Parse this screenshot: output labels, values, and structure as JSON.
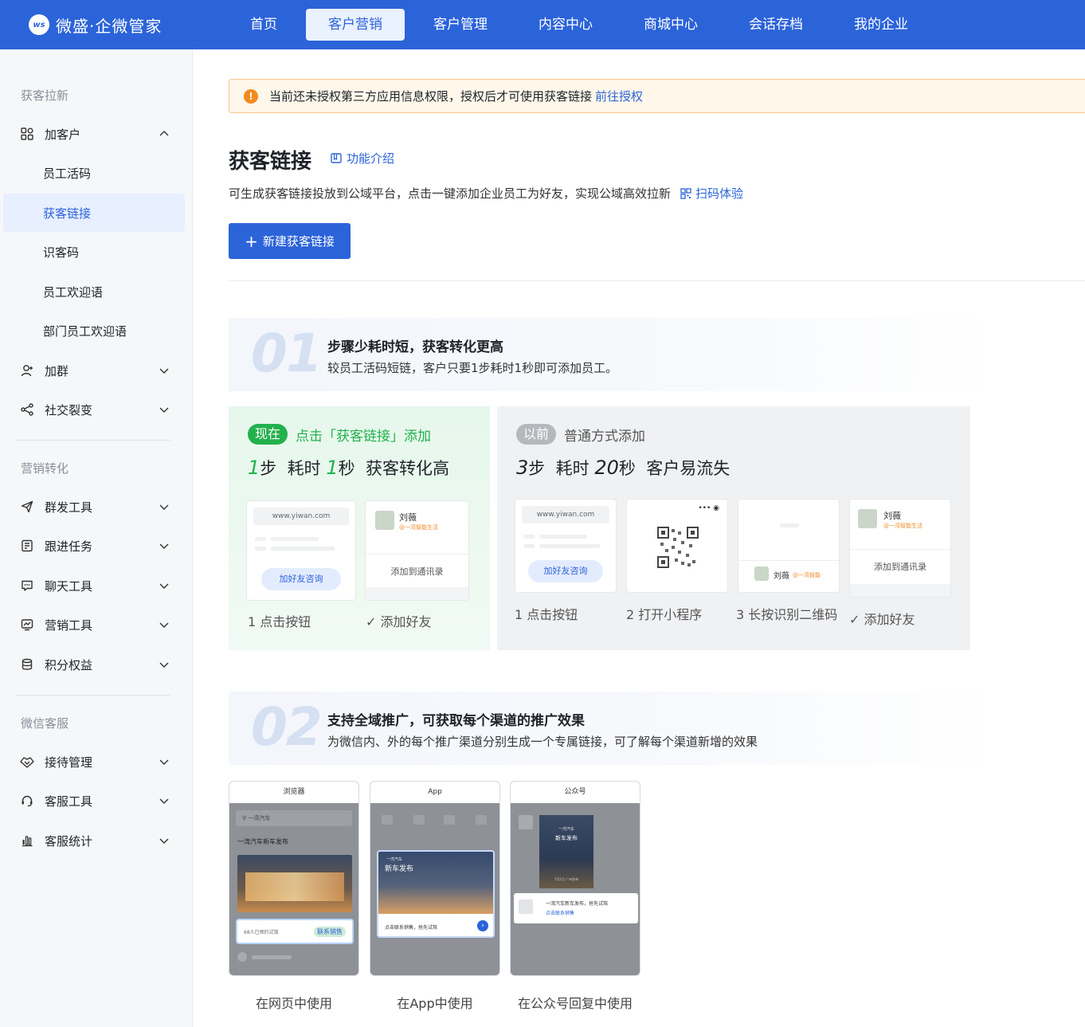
{
  "app": {
    "badge": "ws",
    "name": "微盛·企微管家"
  },
  "nav": [
    "首页",
    "客户营销",
    "客户管理",
    "内容中心",
    "商城中心",
    "会话存档",
    "我的企业"
  ],
  "nav_active": 1,
  "sidebar": {
    "group1": "获客拉新",
    "add_customer": "加客户",
    "sub": [
      "员工活码",
      "获客链接",
      "识客码",
      "员工欢迎语",
      "部门员工欢迎语"
    ],
    "add_group": "加群",
    "social": "社交裂变",
    "group2": "营销转化",
    "g2": [
      "群发工具",
      "跟进任务",
      "聊天工具",
      "营销工具",
      "积分权益"
    ],
    "group3": "微信客服",
    "g3": [
      "接待管理",
      "客服工具",
      "客服统计"
    ]
  },
  "alert": {
    "text": "当前还未授权第三方应用信息权限，授权后才可使用获客链接",
    "link": "前往授权"
  },
  "page": {
    "title": "获客链接",
    "feature": "功能介绍",
    "desc": "可生成获客链接投放到公域平台，点击一键添加企业员工为好友，实现公域高效拉新",
    "scan": "扫码体验",
    "new_button": "新建获客链接"
  },
  "step1": {
    "num": "01",
    "title": "步骤少耗时短，获客转化更高",
    "desc": "较员工活码短链，客户只要1步耗时1秒即可添加员工。"
  },
  "now": {
    "tag": "现在",
    "title": "点击「获客链接」添加",
    "big_a": "1",
    "big_b": "步  耗时 ",
    "big_c": "1",
    "big_d": "秒  获客转化高",
    "url": "www.yiwan.com",
    "btn": "加好友咨询",
    "name": "刘薇",
    "sub": "@一湾智能生活",
    "add": "添加到通讯录",
    "cap1": "1 点击按钮",
    "cap2": "✓ 添加好友"
  },
  "old": {
    "tag": "以前",
    "title": "普通方式添加",
    "big_a": "3",
    "big_b": "步  耗时 ",
    "big_c": "20",
    "big_d": "秒  客户易流失",
    "url": "www.yiwan.com",
    "btn": "加好友咨询",
    "name": "刘薇",
    "sub": "@一湾智能生活",
    "sub2": "@一湾智能",
    "add": "添加到通讯录",
    "cap1": "1 点击按钮",
    "cap2": "2 打开小程序",
    "cap3": "3 长按识别二维码",
    "cap4": "✓ 添加好友"
  },
  "step2": {
    "num": "02",
    "title": "支持全域推广，可获取每个渠道的推广效果",
    "desc": "为微信内、外的每个推广渠道分别生成一个专属链接，可了解每个渠道新增的效果"
  },
  "phones": [
    {
      "head": "浏览器",
      "search": "一湾汽车",
      "t": "一湾汽车新车发布",
      "foot": "68人已预约试驾",
      "cta": "联系销售",
      "cap": "在网页中使用"
    },
    {
      "head": "App",
      "banner_small": "一湾汽车",
      "banner": "新车发布",
      "foot": "点击联系销售，抢先试驾",
      "cap": "在App中使用"
    },
    {
      "head": "公众号",
      "poster_small": "一湾汽车",
      "poster": "新车发布",
      "poster_foot": "7月1日 广州发布",
      "msg1": "一湾汽车新车发布，抢先试驾",
      "msg2": "点击联系销售",
      "cap": "在公众号回复中使用"
    }
  ]
}
